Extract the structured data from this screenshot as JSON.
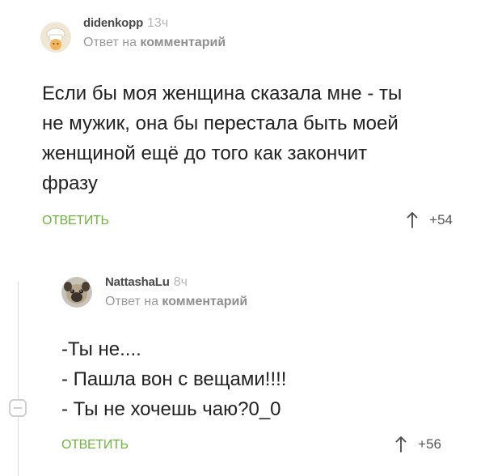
{
  "comments": [
    {
      "username": "didenkopp",
      "time": "13ч",
      "reply_prefix": "Ответ на",
      "reply_link": "комментарий",
      "lines": [
        "Если бы моя женщина сказала мне - ты",
        "не мужик, она бы перестала быть моей",
        "женщиной ещё до того как закончит",
        "фразу"
      ],
      "reply_label": "ОТВЕТИТЬ",
      "score": "+54",
      "avatar_icon": "chef-hat-avatar"
    },
    {
      "username": "NattashaLu",
      "time": "8ч",
      "reply_prefix": "Ответ на",
      "reply_link": "комментарий",
      "lines": [
        "-Ты не....",
        "- Пашла вон с вещами!!!!",
        "- Ты не хочешь чаю?0_0"
      ],
      "reply_label": "ОТВЕТИТЬ",
      "score": "+56",
      "avatar_icon": "pug-avatar"
    }
  ],
  "thread": {
    "collapse_icon": "minus-collapse-icon"
  },
  "colors": {
    "accent_green": "#6fb43c",
    "muted_text": "#9a9a9a",
    "body_text": "#222222"
  }
}
